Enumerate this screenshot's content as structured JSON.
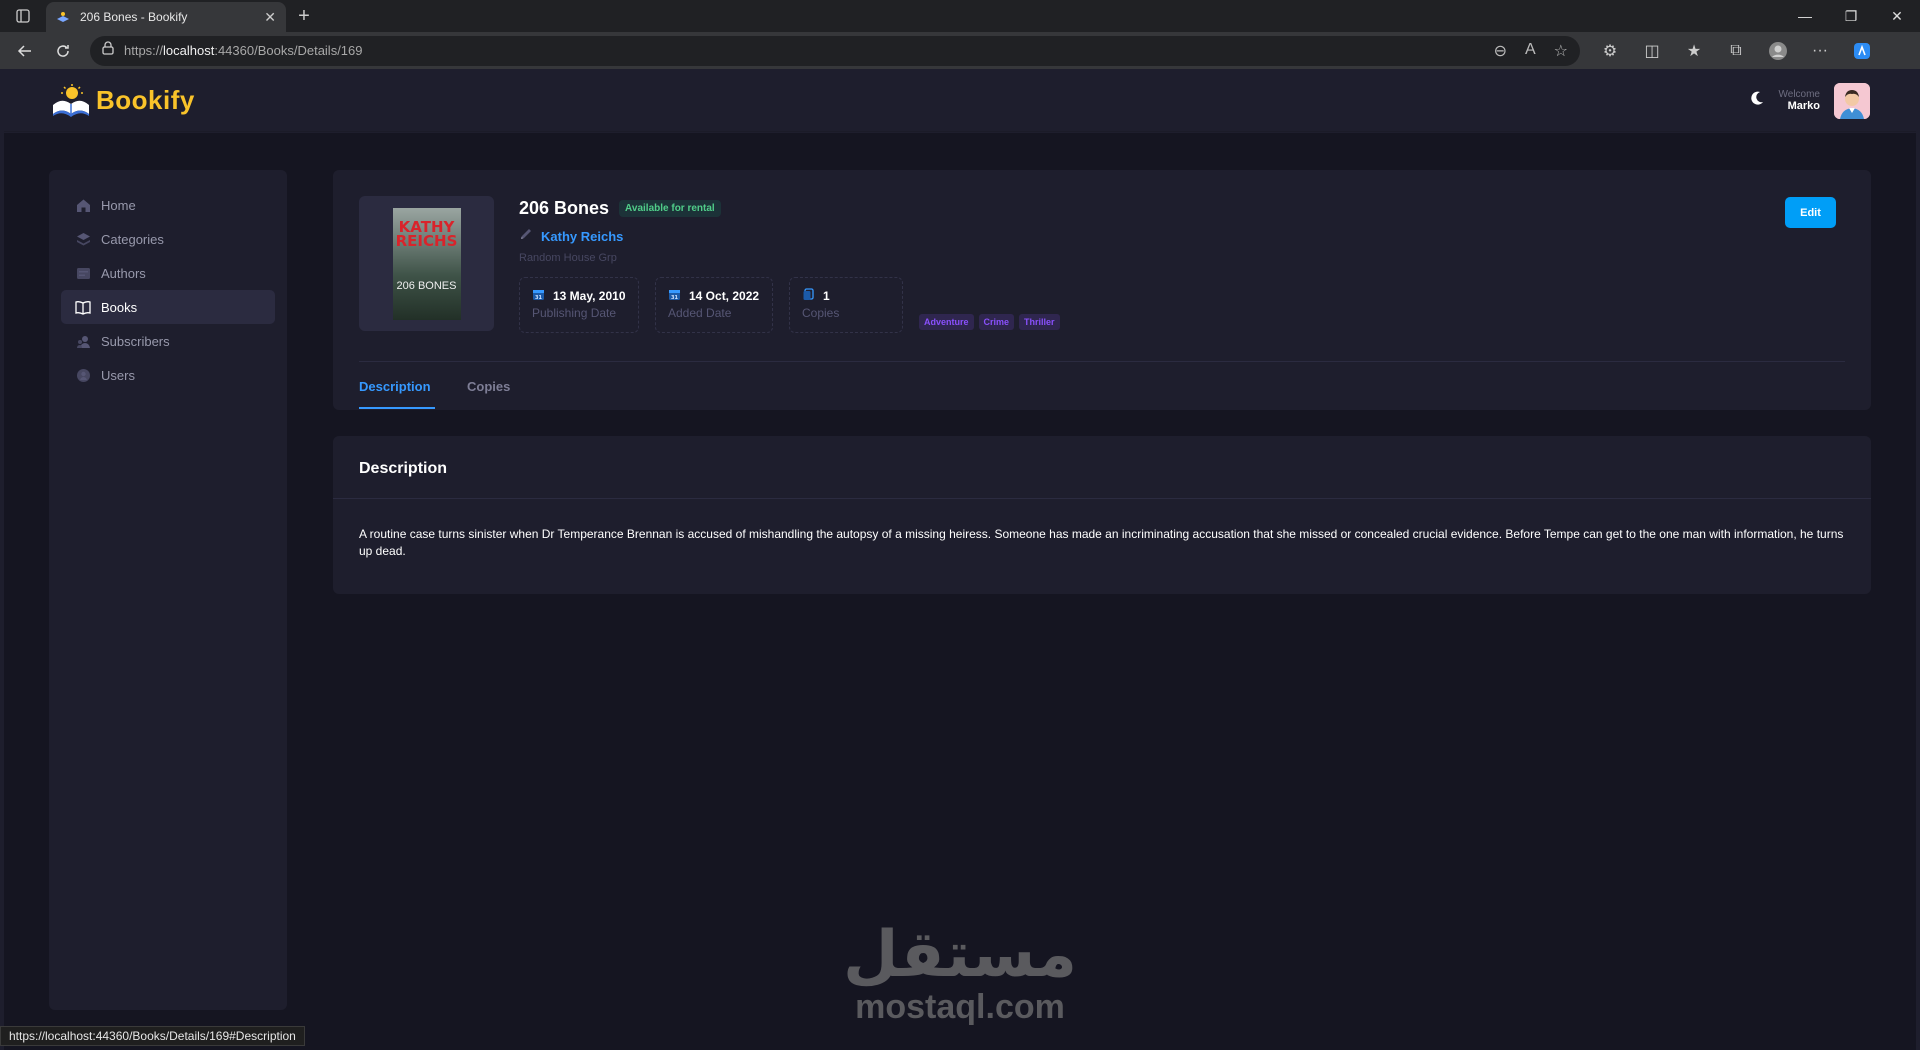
{
  "browser": {
    "tab_title": "206 Bones - Bookify",
    "url_scheme": "https://",
    "url_host": "localhost",
    "url_rest": ":44360/Books/Details/169",
    "status_url": "https://localhost:44360/Books/Details/169#Description"
  },
  "app": {
    "logo_text": "Bookify",
    "welcome_label": "Welcome",
    "user_name": "Marko"
  },
  "sidebar": {
    "items": [
      {
        "label": "Home",
        "icon": "home-icon"
      },
      {
        "label": "Categories",
        "icon": "layers-icon"
      },
      {
        "label": "Authors",
        "icon": "card-icon"
      },
      {
        "label": "Books",
        "icon": "book-icon",
        "active": true
      },
      {
        "label": "Subscribers",
        "icon": "users-icon"
      },
      {
        "label": "Users",
        "icon": "user-icon"
      }
    ]
  },
  "book": {
    "title": "206 Bones",
    "status": "Available for rental",
    "author": "Kathy Reichs",
    "publisher": "Random House Grp",
    "cover_top": "KATHY REICHS",
    "cover_bottom": "206 BONES",
    "publishing_date": "13 May, 2010",
    "publishing_date_label": "Publishing Date",
    "added_date": "14 Oct, 2022",
    "added_date_label": "Added Date",
    "copies": "1",
    "copies_label": "Copies",
    "tags": [
      "Adventure",
      "Crime",
      "Thriller"
    ],
    "edit_label": "Edit"
  },
  "tabs": {
    "description": "Description",
    "copies": "Copies"
  },
  "description": {
    "heading": "Description",
    "text": "A routine case turns sinister when Dr Temperance Brennan is accused of mishandling the autopsy of a missing heiress. Someone has made an incriminating accusation that she missed or concealed crucial evidence. Before Tempe can get to the one man with information, he turns up dead."
  },
  "watermark": {
    "arabic": "مستقل",
    "latin": "mostaql.com"
  },
  "colors": {
    "accent": "#3699ff",
    "primary_button": "#009ef7",
    "success": "#50cd89",
    "tag": "#8950fc",
    "logo": "#f9c32a"
  }
}
